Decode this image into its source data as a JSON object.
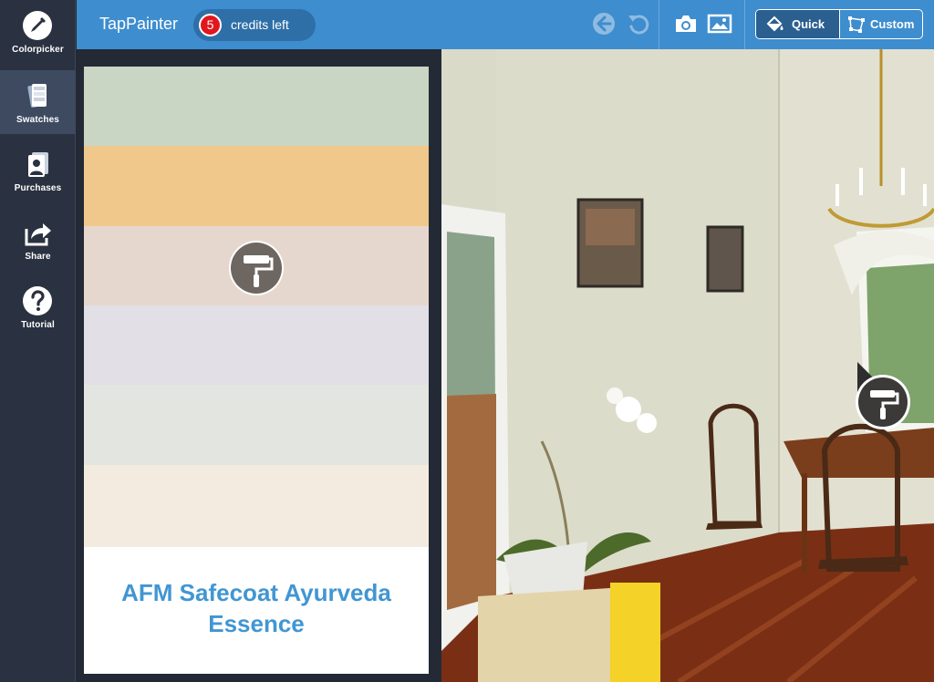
{
  "nav": {
    "items": [
      {
        "label": "Colorpicker",
        "icon": "eyedropper-icon"
      },
      {
        "label": "Swatches",
        "icon": "swatches-icon",
        "active": true
      },
      {
        "label": "Purchases",
        "icon": "purchases-icon"
      },
      {
        "label": "Share",
        "icon": "share-icon"
      },
      {
        "label": "Tutorial",
        "icon": "question-icon"
      }
    ]
  },
  "topbar": {
    "title": "TapPainter",
    "credits": {
      "count": "5",
      "label": "credits left"
    },
    "modes": {
      "quick": "Quick",
      "custom": "Custom",
      "selected": "quick"
    }
  },
  "swatches": {
    "colors": [
      "#c9d6c3",
      "#f0c88b",
      "#e6d7ce",
      "#e3dfe6",
      "#e2e5e0",
      "#f3ebdf"
    ],
    "name": "AFM Safecoat Ayurveda Essence"
  }
}
